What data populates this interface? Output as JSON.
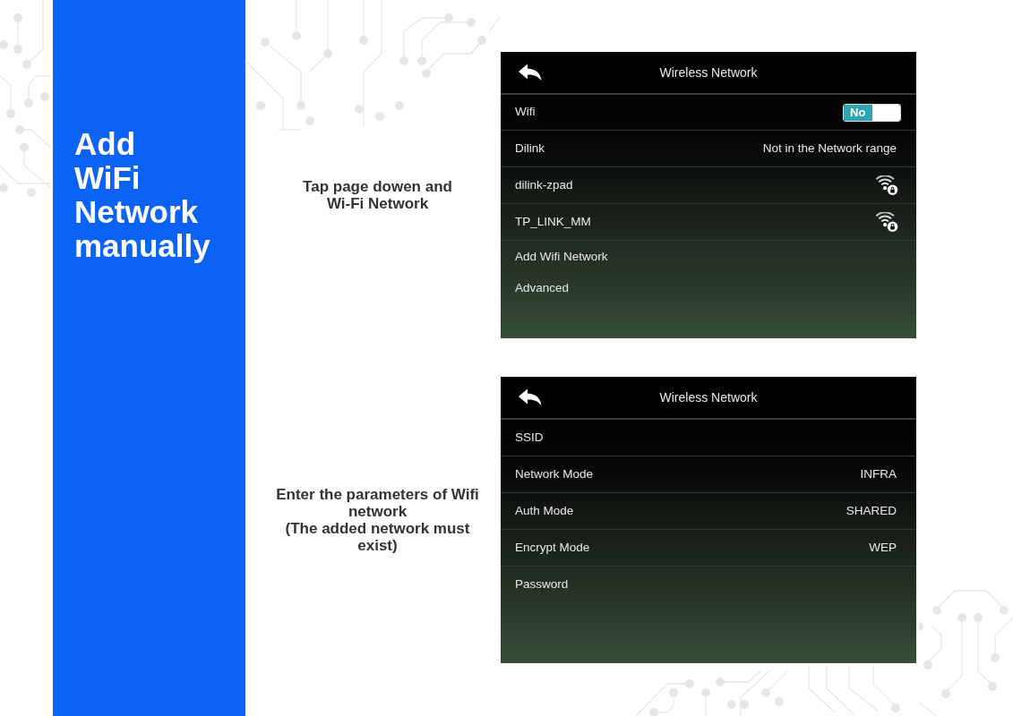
{
  "sidebar": {
    "title": [
      "Add",
      "WiFi",
      "Network",
      "manually"
    ]
  },
  "steps": [
    {
      "instruction": [
        "Tap page dowen and",
        "Wi-Fi Network"
      ],
      "screen": {
        "title": "Wireless Network",
        "rows": [
          {
            "kind": "toggle",
            "label": "Wifi",
            "toggle": {
              "text": "No",
              "on": false
            }
          },
          {
            "kind": "value",
            "label": "Dilink",
            "value": "Not in the Network range"
          },
          {
            "kind": "network",
            "label": "dilink-zpad",
            "locked": true
          },
          {
            "kind": "network",
            "label": "TP_LINK_MM",
            "locked": true
          },
          {
            "kind": "link",
            "label": "Add Wifi Network"
          },
          {
            "kind": "link",
            "label": "Advanced"
          }
        ]
      }
    },
    {
      "instruction": [
        "Enter the parameters of Wifi",
        "network",
        "(The added network must",
        "exist)"
      ],
      "screen": {
        "title": "Wireless Network",
        "rows": [
          {
            "kind": "field",
            "label": "SSID"
          },
          {
            "kind": "value",
            "label": "Network Mode",
            "value": "INFRA"
          },
          {
            "kind": "value",
            "label": "Auth Mode",
            "value": "SHARED"
          },
          {
            "kind": "value",
            "label": "Encrypt Mode",
            "value": "WEP"
          },
          {
            "kind": "field",
            "label": "Password"
          }
        ]
      }
    }
  ]
}
